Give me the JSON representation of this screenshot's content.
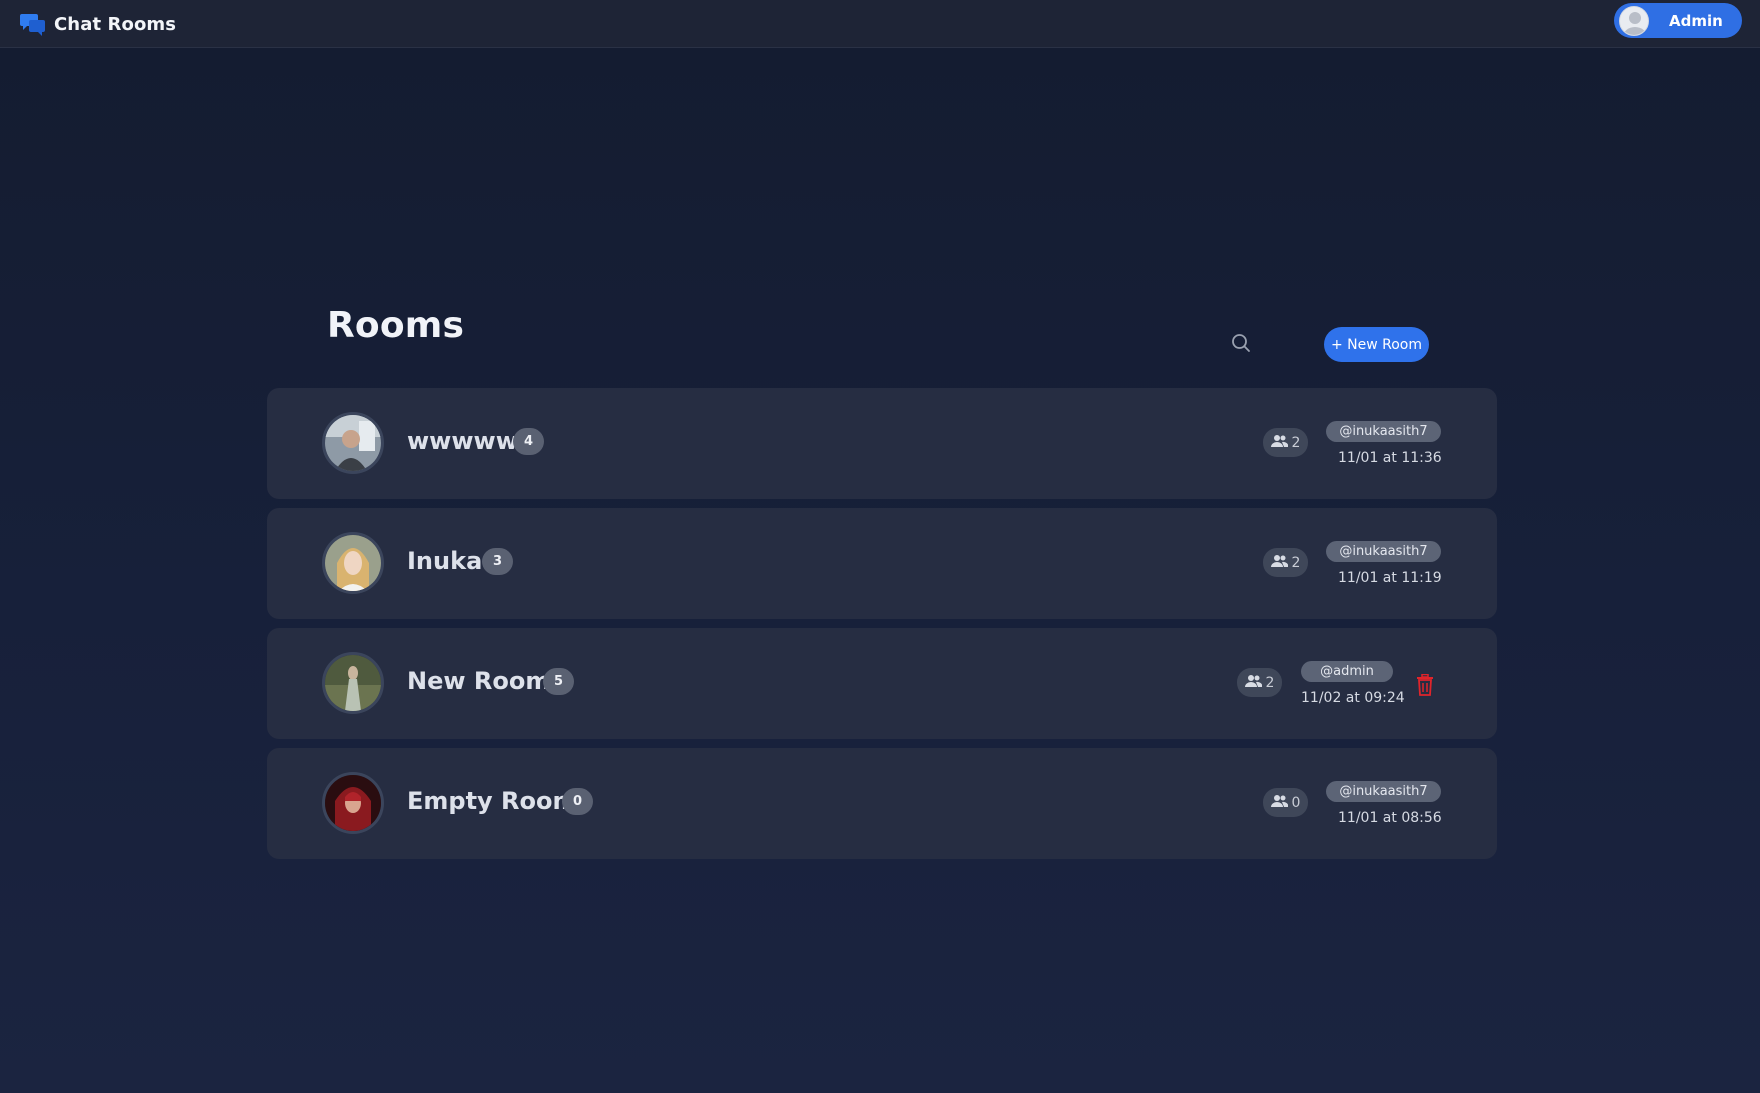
{
  "app": {
    "title": "Chat Rooms",
    "accent_color": "#2f72eb",
    "danger_color": "#e0242b"
  },
  "header": {
    "user_label": "Admin",
    "user_avatar_icon": "user-avatar-icon"
  },
  "main": {
    "title": "Rooms",
    "search_icon": "search-icon",
    "new_room_label": "+ New Room"
  },
  "rooms": [
    {
      "name": "wwwww",
      "message_count": "4",
      "members": "2",
      "owner": "@inukaasith7",
      "time": "11/01 at 11:36",
      "can_delete": false
    },
    {
      "name": "Inuka",
      "message_count": "3",
      "members": "2",
      "owner": "@inukaasith7",
      "time": "11/01 at 11:19",
      "can_delete": false
    },
    {
      "name": "New Room",
      "message_count": "5",
      "members": "2",
      "owner": "@admin",
      "time": "11/02 at 09:24",
      "can_delete": true
    },
    {
      "name": "Empty Room",
      "message_count": "0",
      "members": "0",
      "owner": "@inukaasith7",
      "time": "11/01 at 08:56",
      "can_delete": false
    }
  ]
}
